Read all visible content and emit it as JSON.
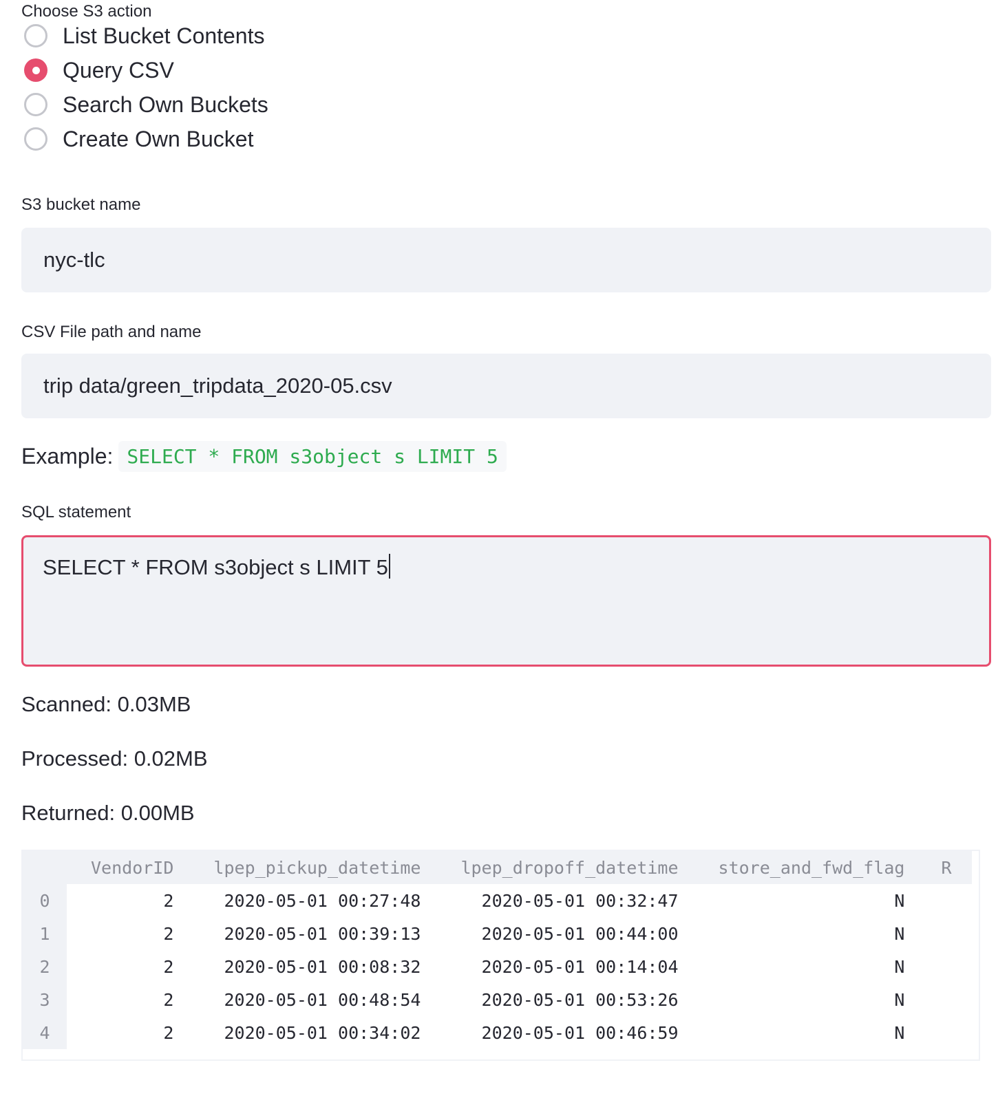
{
  "s3_action": {
    "label": "Choose S3 action",
    "options": [
      {
        "label": "List Bucket Contents",
        "selected": false
      },
      {
        "label": "Query CSV",
        "selected": true
      },
      {
        "label": "Search Own Buckets",
        "selected": false
      },
      {
        "label": "Create Own Bucket",
        "selected": false
      }
    ]
  },
  "bucket": {
    "label": "S3 bucket name",
    "value": "nyc-tlc"
  },
  "csv_path": {
    "label": "CSV File path and name",
    "value": "trip data/green_tripdata_2020-05.csv"
  },
  "example": {
    "label": "Example:",
    "code": "SELECT * FROM s3object s LIMIT 5"
  },
  "sql": {
    "label": "SQL statement",
    "value": "SELECT * FROM s3object s LIMIT 5"
  },
  "stats": {
    "scanned": "Scanned: 0.03MB",
    "processed": "Processed: 0.02MB",
    "returned": "Returned: 0.00MB"
  },
  "colors": {
    "accent": "#e64d6e",
    "code_green": "#2eab4f",
    "input_bg": "#f0f2f6"
  },
  "table": {
    "columns": [
      "VendorID",
      "lpep_pickup_datetime",
      "lpep_dropoff_datetime",
      "store_and_fwd_flag",
      "R"
    ],
    "rows": [
      {
        "index": "0",
        "cells": [
          "2",
          "2020-05-01 00:27:48",
          "2020-05-01 00:32:47",
          "N",
          ""
        ]
      },
      {
        "index": "1",
        "cells": [
          "2",
          "2020-05-01 00:39:13",
          "2020-05-01 00:44:00",
          "N",
          ""
        ]
      },
      {
        "index": "2",
        "cells": [
          "2",
          "2020-05-01 00:08:32",
          "2020-05-01 00:14:04",
          "N",
          ""
        ]
      },
      {
        "index": "3",
        "cells": [
          "2",
          "2020-05-01 00:48:54",
          "2020-05-01 00:53:26",
          "N",
          ""
        ]
      },
      {
        "index": "4",
        "cells": [
          "2",
          "2020-05-01 00:34:02",
          "2020-05-01 00:46:59",
          "N",
          ""
        ]
      }
    ]
  }
}
